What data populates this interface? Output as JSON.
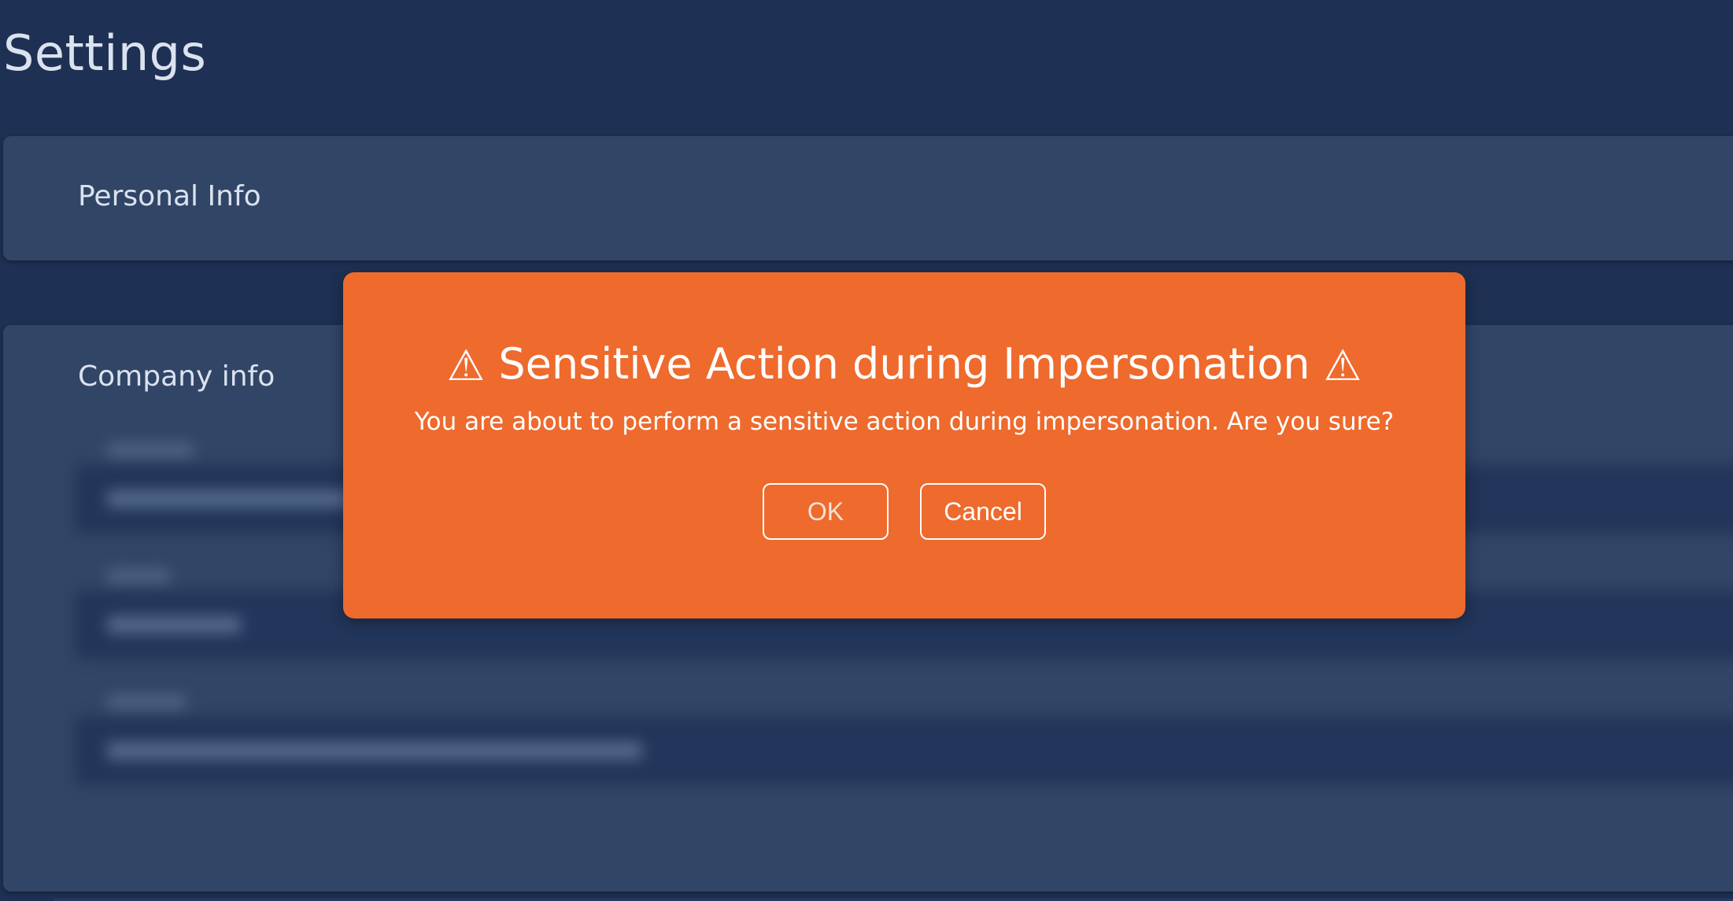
{
  "page": {
    "title": "Settings"
  },
  "sections": {
    "personal": {
      "title": "Personal Info"
    },
    "company": {
      "title": "Company info"
    }
  },
  "dialog": {
    "title": "Sensitive Action during Impersonation",
    "warning_glyph": "⚠",
    "message": "You are about to perform a sensitive action during impersonation. Are you sure?",
    "ok_label": "OK",
    "cancel_label": "Cancel",
    "icons": {
      "leading": "warning-icon",
      "trailing": "warning-icon"
    }
  },
  "colors": {
    "background": "#1e3053",
    "panel": "#314566",
    "dialog_accent": "#ee6a2d",
    "text": "#dbe2ef"
  }
}
